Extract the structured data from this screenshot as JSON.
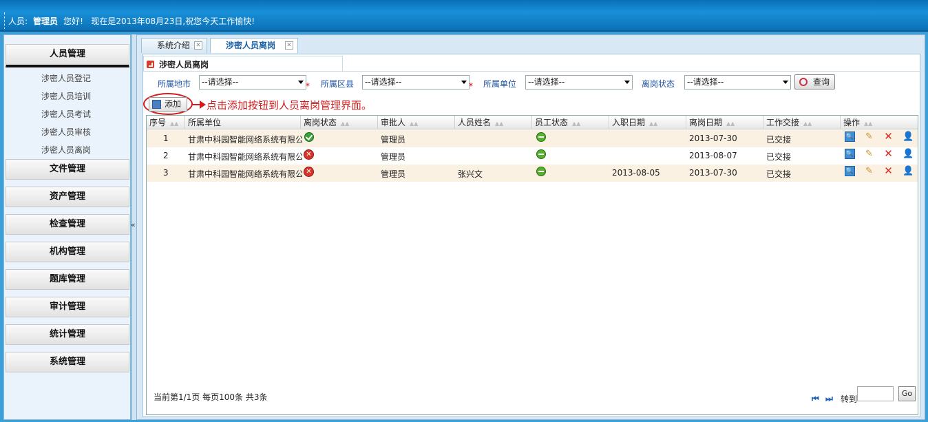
{
  "topbar": {
    "person_label": "人员:",
    "user": "管理员",
    "greeting": "您好!",
    "datetime": "现在是2013年08月23日,祝您今天工作愉快!"
  },
  "sidebar": {
    "groups": [
      "人员管理",
      "文件管理",
      "资产管理",
      "检查管理",
      "机构管理",
      "题库管理",
      "审计管理",
      "统计管理",
      "系统管理"
    ],
    "people_items": [
      "涉密人员登记",
      "涉密人员培训",
      "涉密人员考试",
      "涉密人员审核",
      "涉密人员离岗"
    ],
    "collapse_glyph": "«"
  },
  "tabs": [
    {
      "label": "系统介绍"
    },
    {
      "label": "涉密人员离岗"
    }
  ],
  "panel": {
    "title": "涉密人员离岗"
  },
  "filters": {
    "city_label": "所属地市",
    "city_value": "--请选择--",
    "district_label": "所属区县",
    "district_value": "--请选择--",
    "unit_label": "所属单位",
    "unit_value": "--请选择--",
    "status_label": "离岗状态",
    "status_value": "--请选择--",
    "required_mark": "*",
    "query_label": "查询"
  },
  "toolbar": {
    "add_label": "添加",
    "hint": "点击添加按钮到人员离岗管理界面。"
  },
  "table": {
    "headers": [
      "序号",
      "所属单位",
      "离岗状态",
      "审批人",
      "人员姓名",
      "员工状态",
      "入职日期",
      "离岗日期",
      "工作交接",
      "操作"
    ],
    "rows": [
      {
        "no": "1",
        "unit": "甘肃中科园智能网络系统有限公",
        "leave_status": "approved",
        "approver": "管理员",
        "name": "",
        "emp_status": "active",
        "entry_date": "",
        "leave_date": "2013-07-30",
        "handover": "已交接"
      },
      {
        "no": "2",
        "unit": "甘肃中科园智能网络系统有限公",
        "leave_status": "rejected",
        "approver": "管理员",
        "name": "",
        "emp_status": "active",
        "entry_date": "",
        "leave_date": "2013-08-07",
        "handover": "已交接"
      },
      {
        "no": "3",
        "unit": "甘肃中科园智能网络系统有限公",
        "leave_status": "rejected",
        "approver": "管理员",
        "name": "张兴文",
        "emp_status": "active",
        "entry_date": "2013-08-05",
        "leave_date": "2013-07-30",
        "handover": "已交接"
      }
    ]
  },
  "footer": {
    "page_info": "当前第1/1页 每页100条 共3条",
    "first_glyph": "⏮",
    "last_glyph": "⏭",
    "goto_label": "转到",
    "go_label": "Go"
  },
  "colors": {
    "accent": "#1890d8",
    "hint_red": "#d21b1b"
  }
}
